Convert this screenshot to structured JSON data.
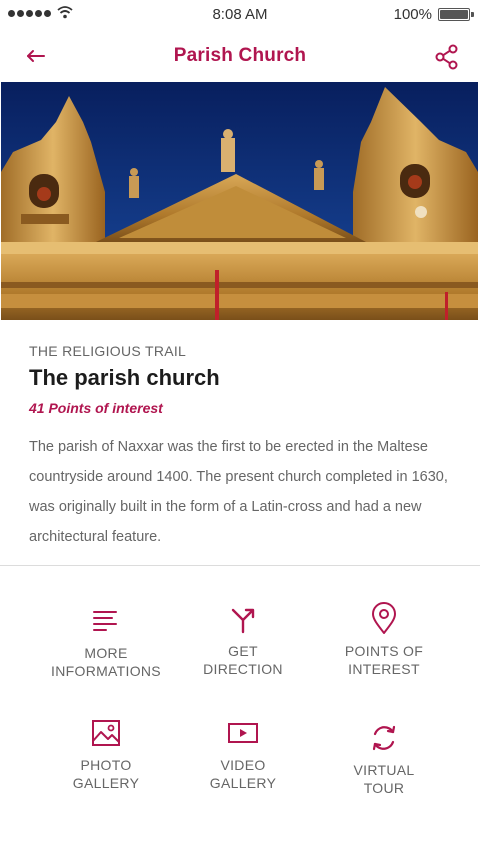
{
  "status_bar": {
    "time": "8:08 AM",
    "battery": "100%"
  },
  "nav": {
    "title": "Parish Church",
    "back_icon": "arrow-left-icon",
    "share_icon": "share-icon"
  },
  "info": {
    "trail": "THE RELIGIOUS TRAIL",
    "title": "The parish church",
    "points_count": "41 Points of interest",
    "description": "The parish of Naxxar was the first to be erected in the Maltese countryside around 1400. The present church completed in 1630, was originally built in the form of a Latin-cross and had a new architectural feature."
  },
  "actions": [
    {
      "line1": "MORE",
      "line2": "INFORMATIONS",
      "icon": "lines-icon"
    },
    {
      "line1": "GET",
      "line2": "DIRECTION",
      "icon": "direction-icon"
    },
    {
      "line1": "POINTS OF",
      "line2": "INTEREST",
      "icon": "map-pin-icon"
    },
    {
      "line1": "PHOTO",
      "line2": "GALLERY",
      "icon": "image-icon"
    },
    {
      "line1": "VIDEO",
      "line2": "GALLERY",
      "icon": "video-icon"
    },
    {
      "line1": "VIRTUAL",
      "line2": "TOUR",
      "icon": "rotate-icon"
    }
  ],
  "colors": {
    "accent": "#b0154f",
    "text_muted": "#666666",
    "sky": "#0c2f7a",
    "stone": "#b9862f"
  }
}
